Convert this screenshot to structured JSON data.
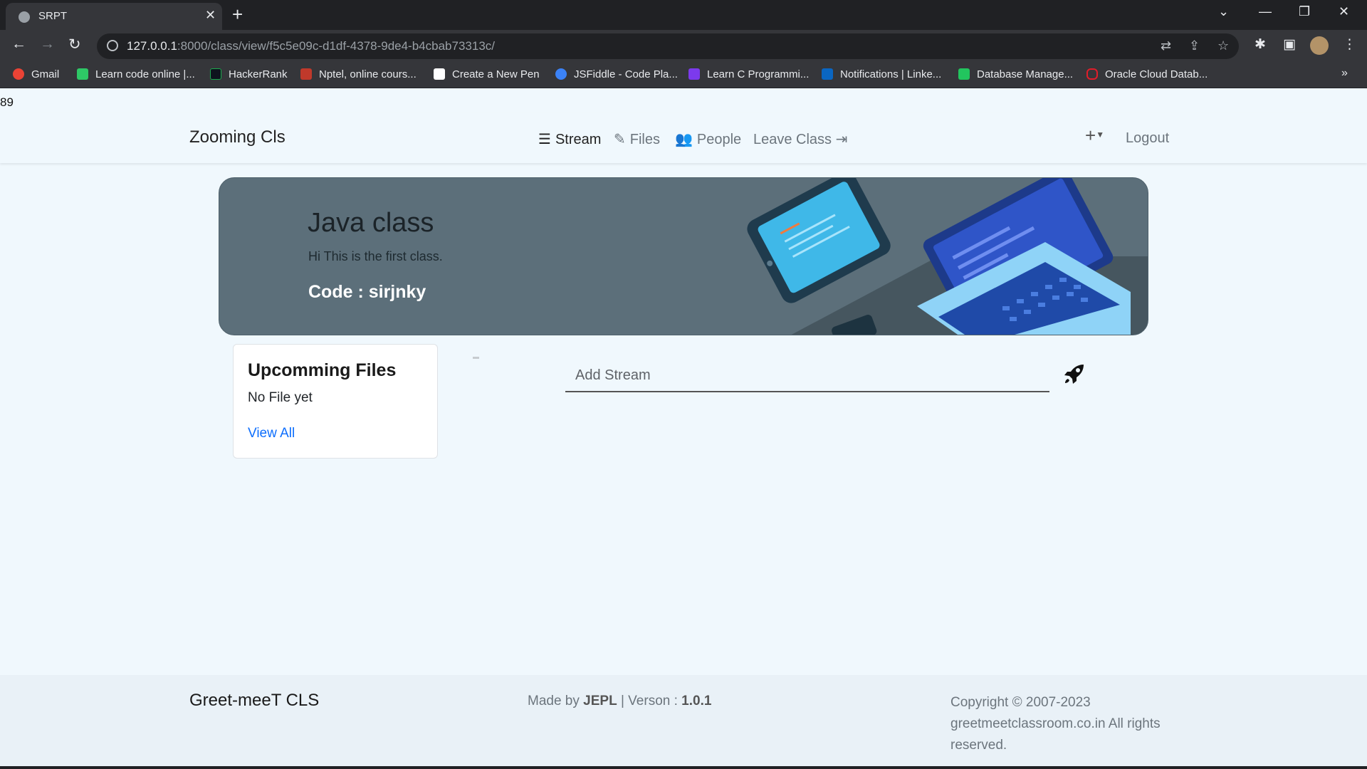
{
  "browser": {
    "tab_title": "SRPT",
    "url_host": "127.0.0.1",
    "url_rest": ":8000/class/view/f5c5e09c-d1df-4378-9de4-b4cbab73313c/",
    "bookmarks": [
      {
        "label": "Gmail",
        "color": "#ea4335"
      },
      {
        "label": "Learn code online |...",
        "color": "#2ec866"
      },
      {
        "label": "HackerRank",
        "color": "#1ba94c"
      },
      {
        "label": "Nptel, online cours...",
        "color": "#c0392b"
      },
      {
        "label": "Create a New Pen",
        "color": "#ffffff"
      },
      {
        "label": "JSFiddle - Code Pla...",
        "color": "#3b82f6"
      },
      {
        "label": "Learn C Programmi...",
        "color": "#7c3aed"
      },
      {
        "label": "Notifications | Linke...",
        "color": "#0a66c2"
      },
      {
        "label": "Database Manage...",
        "color": "#22c55e"
      },
      {
        "label": "Oracle Cloud Datab...",
        "color": "#e11d2a"
      }
    ]
  },
  "page": {
    "counter": "89"
  },
  "navbar": {
    "brand": "Zooming Cls",
    "links": {
      "stream": "Stream",
      "files": "Files",
      "people": "People",
      "leave": "Leave Class"
    },
    "logout": "Logout"
  },
  "banner": {
    "title": "Java class",
    "description": "Hi This is the first class.",
    "code": "Code : sirjnky"
  },
  "upcoming": {
    "title": "Upcomming Files",
    "empty_text": "No File yet",
    "view_all": "View All"
  },
  "stream": {
    "placeholder": "Add Stream"
  },
  "footer": {
    "brand": "Greet-meeT CLS",
    "made_prefix": "Made by ",
    "made_by": "JEPL",
    "version_prefix": " | Verson : ",
    "version": "1.0.1",
    "copyright": "Copyright © 2007-2023 greetmeetclassroom.co.in All rights reserved."
  },
  "colors": {
    "page_bg": "#f0f8fd",
    "banner_bg": "#5c6f7a",
    "link": "#0d6efd"
  }
}
